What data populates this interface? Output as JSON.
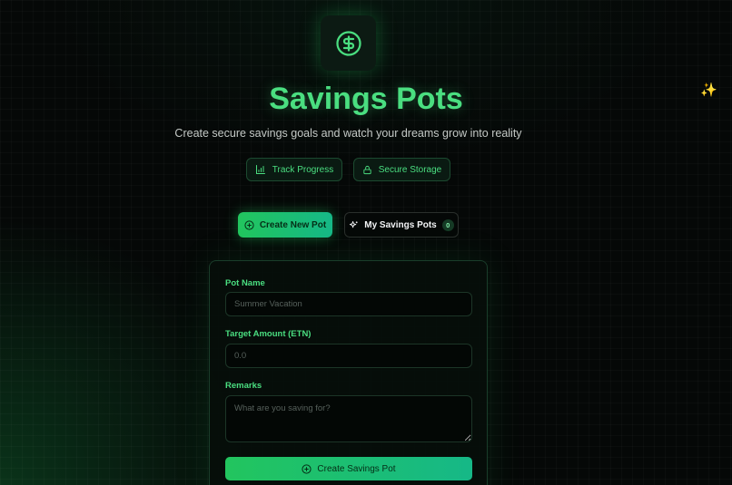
{
  "header": {
    "title": "Savings Pots",
    "subtitle": "Create secure savings goals and watch your dreams grow into reality",
    "logo_icon": "dollar-circle-icon",
    "sparkle_icon": "sparkles-icon"
  },
  "badges": {
    "track": {
      "label": "Track Progress",
      "icon": "bar-chart-icon"
    },
    "secure": {
      "label": "Secure Storage",
      "icon": "lock-icon"
    }
  },
  "tabs": {
    "create": {
      "label": "Create New Pot",
      "icon": "plus-circle-icon"
    },
    "my_pots": {
      "label": "My Savings Pots",
      "icon": "sparkles-icon",
      "count": "0"
    }
  },
  "form": {
    "pot_name": {
      "label": "Pot Name",
      "placeholder": "Summer Vacation",
      "value": ""
    },
    "target_amount": {
      "label": "Target Amount (ETN)",
      "placeholder": "0.0",
      "value": ""
    },
    "remarks": {
      "label": "Remarks",
      "placeholder": "What are you saving for?",
      "value": ""
    },
    "submit": {
      "label": "Create Savings Pot",
      "icon": "plus-circle-icon"
    }
  },
  "colors": {
    "accent": "#4ade80",
    "accent_dark": "#22c55e",
    "background": "#050807"
  }
}
